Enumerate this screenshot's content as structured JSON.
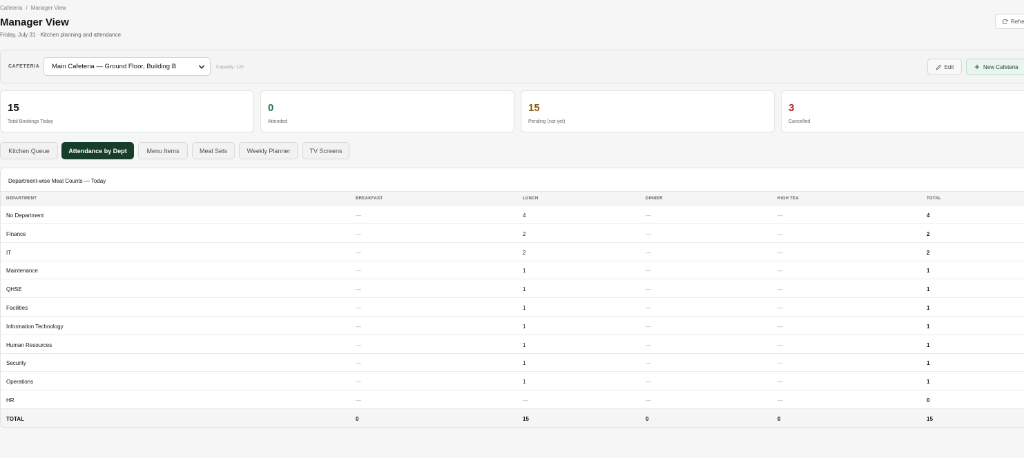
{
  "breadcrumb": {
    "parent": "Cafeteria",
    "separator": "/",
    "current": "Manager View"
  },
  "header": {
    "title": "Manager View",
    "subtitle": "Friday, July 31 · Kitchen planning and attendance",
    "refresh_label": "Refresh"
  },
  "cafeteria_bar": {
    "label": "CAFETERIA",
    "selected": "Main Cafeteria — Ground Floor, Building B",
    "capacity": "Capacity: 120",
    "edit_label": "Edit",
    "new_label": "New Cafeteria"
  },
  "stats": [
    {
      "value": "15",
      "label": "Total Bookings Today",
      "color": "#111111"
    },
    {
      "value": "0",
      "label": "Attended",
      "color": "#1f7a3e"
    },
    {
      "value": "15",
      "label": "Pending (not yet)",
      "color": "#8a5a12"
    },
    {
      "value": "3",
      "label": "Cancelled",
      "color": "#b0222a"
    }
  ],
  "tabs": [
    {
      "label": "Kitchen Queue"
    },
    {
      "label": "Attendance by Dept"
    },
    {
      "label": "Menu Items"
    },
    {
      "label": "Meal Sets"
    },
    {
      "label": "Weekly Planner"
    },
    {
      "label": "TV Screens"
    }
  ],
  "active_tab": "Attendance by Dept",
  "table": {
    "title": "Department-wise Meal Counts — Today",
    "columns": [
      "DEPARTMENT",
      "BREAKFAST",
      "LUNCH",
      "DINNER",
      "HIGH TEA",
      "TOTAL"
    ],
    "rows": [
      [
        "No Department",
        "—",
        "4",
        "—",
        "—",
        "4"
      ],
      [
        "Finance",
        "—",
        "2",
        "—",
        "—",
        "2"
      ],
      [
        "IT",
        "—",
        "2",
        "—",
        "—",
        "2"
      ],
      [
        "Maintenance",
        "—",
        "1",
        "—",
        "—",
        "1"
      ],
      [
        "QHSE",
        "—",
        "1",
        "—",
        "—",
        "1"
      ],
      [
        "Facilities",
        "—",
        "1",
        "—",
        "—",
        "1"
      ],
      [
        "Information Technology",
        "—",
        "1",
        "—",
        "—",
        "1"
      ],
      [
        "Human Resources",
        "—",
        "1",
        "—",
        "—",
        "1"
      ],
      [
        "Security",
        "—",
        "1",
        "—",
        "—",
        "1"
      ],
      [
        "Operations",
        "—",
        "1",
        "—",
        "—",
        "1"
      ],
      [
        "HR",
        "—",
        "—",
        "—",
        "—",
        "0"
      ]
    ],
    "total_row": [
      "TOTAL",
      "0",
      "15",
      "0",
      "0",
      "15"
    ]
  }
}
